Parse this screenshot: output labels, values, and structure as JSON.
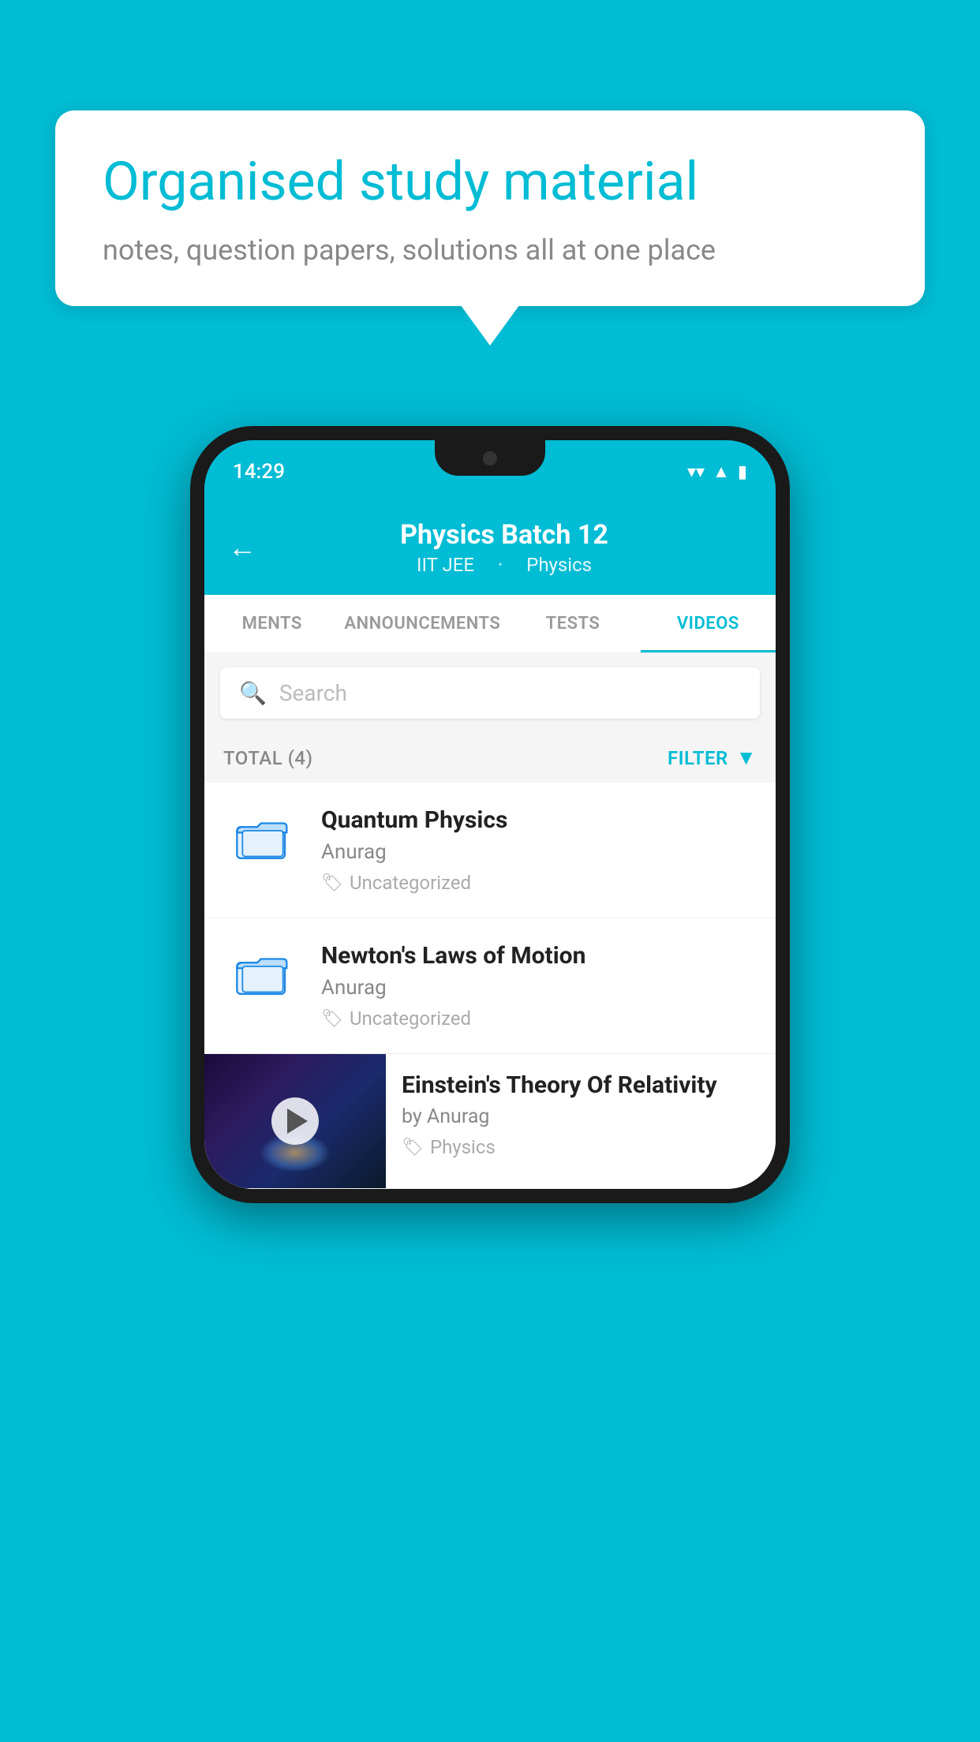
{
  "background_color": "#00BCD4",
  "speech_bubble": {
    "heading": "Organised study material",
    "subtext": "notes, question papers, solutions all at one place"
  },
  "phone": {
    "status_bar": {
      "time": "14:29"
    },
    "header": {
      "back_label": "←",
      "title": "Physics Batch 12",
      "subtitle_part1": "IIT JEE",
      "subtitle_part2": "Physics"
    },
    "tabs": [
      {
        "label": "MENTS",
        "active": false
      },
      {
        "label": "ANNOUNCEMENTS",
        "active": false
      },
      {
        "label": "TESTS",
        "active": false
      },
      {
        "label": "VIDEOS",
        "active": true
      }
    ],
    "search": {
      "placeholder": "Search"
    },
    "filter_bar": {
      "total_label": "TOTAL (4)",
      "filter_label": "FILTER"
    },
    "video_items": [
      {
        "title": "Quantum Physics",
        "author": "Anurag",
        "tag": "Uncategorized",
        "has_thumb": false
      },
      {
        "title": "Newton's Laws of Motion",
        "author": "Anurag",
        "tag": "Uncategorized",
        "has_thumb": false
      },
      {
        "title": "Einstein's Theory Of Relativity",
        "author": "by Anurag",
        "tag": "Physics",
        "has_thumb": true
      }
    ]
  }
}
